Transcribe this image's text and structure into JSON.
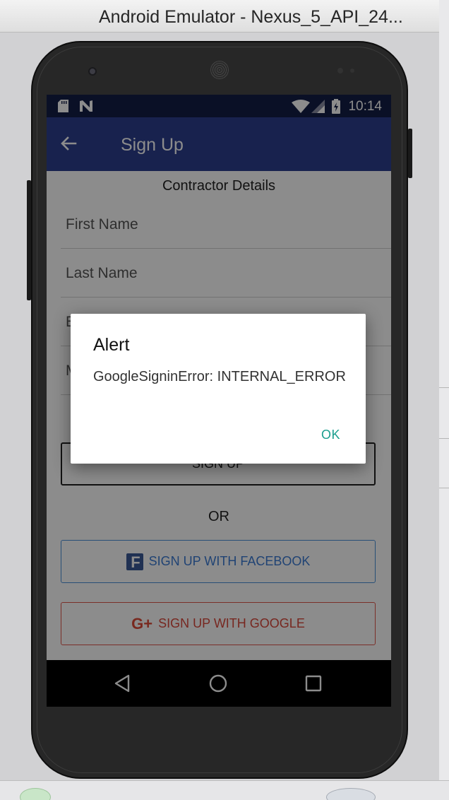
{
  "window": {
    "title": "Android Emulator - Nexus_5_API_24..."
  },
  "status_bar": {
    "time": "10:14",
    "icons": [
      "sd-card-icon",
      "n-notification-icon",
      "wifi-icon",
      "signal-icon",
      "battery-charging-icon"
    ]
  },
  "app_bar": {
    "title": "Sign Up",
    "back_icon": "arrow-back-icon"
  },
  "form": {
    "section_title": "Contractor Details",
    "first_name_placeholder": "First Name",
    "last_name_placeholder": "Last Name",
    "email_placeholder": "E",
    "mobile_placeholder": "M"
  },
  "buttons": {
    "sign_up": "SIGN UP",
    "or": "OR",
    "facebook": "SIGN UP WITH FACEBOOK",
    "google": "SIGN UP WITH GOOGLE",
    "google_icon_text": "G+"
  },
  "dialog": {
    "title": "Alert",
    "message": "GoogleSigninError: INTERNAL_ERROR",
    "ok": "OK"
  },
  "nav_bar": {
    "icons": [
      "back-triangle-icon",
      "home-circle-icon",
      "recents-square-icon"
    ]
  },
  "colors": {
    "status_bar": "#131e46",
    "app_bar": "#2c3f8f",
    "facebook": "#3b7bd4",
    "google": "#d9483b",
    "dialog_accent": "#1a9e8e"
  }
}
